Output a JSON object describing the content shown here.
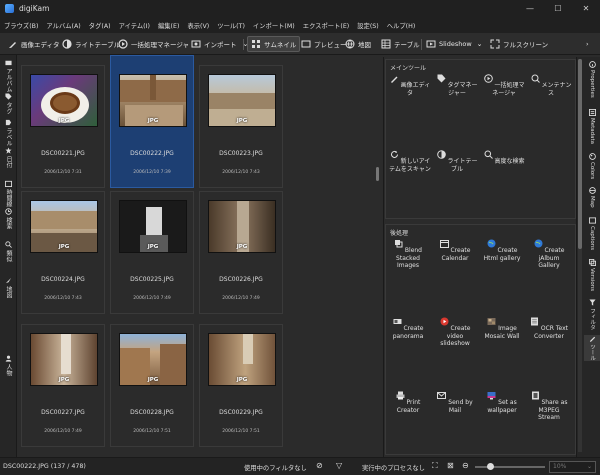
{
  "window": {
    "title": "digiKam",
    "controls": [
      "minimize-icon",
      "maximize-icon",
      "close-icon"
    ]
  },
  "menu": [
    "ブラウズ(B)",
    "アルバム(A)",
    "タグ(A)",
    "アイテム(I)",
    "編集(E)",
    "表示(V)",
    "ツール(T)",
    "インポート(M)",
    "エクスポート(E)",
    "設定(S)",
    "ヘルプ(H)"
  ],
  "toolbar": {
    "image_editor": "画像エディタ",
    "light_table": "ライトテーブル",
    "batch_queue": "一括処理マネージャ",
    "import": "インポート",
    "thumbnails": "サムネイル",
    "preview": "プレビュー",
    "map": "地図",
    "table": "テーブル",
    "slideshow": "Slideshow",
    "fullscreen": "フルスクリーン"
  },
  "left_tabs": [
    "アルバム",
    "タグ",
    "ラベル",
    "日付",
    "時間線",
    "検索",
    "類似",
    "地図",
    "人物"
  ],
  "thumbnails": [
    {
      "name": "DSC00221.JPG",
      "date": "2006/12/10 7:31",
      "badge": "JPG",
      "selected": false
    },
    {
      "name": "DSC00222.JPG",
      "date": "2006/12/10 7:39",
      "badge": "JPG",
      "selected": true
    },
    {
      "name": "DSC00223.JPG",
      "date": "2006/12/10 7:43",
      "badge": "JPG",
      "selected": false
    },
    {
      "name": "DSC00224.JPG",
      "date": "2006/12/10 7:43",
      "badge": "JPG",
      "selected": false
    },
    {
      "name": "DSC00225.JPG",
      "date": "2006/12/10 7:49",
      "badge": "JPG",
      "selected": false
    },
    {
      "name": "DSC00226.JPG",
      "date": "2006/12/10 7:49",
      "badge": "JPG",
      "selected": false
    },
    {
      "name": "DSC00227.JPG",
      "date": "2006/12/10 7:49",
      "badge": "JPG",
      "selected": false
    },
    {
      "name": "DSC00228.JPG",
      "date": "2006/12/10 7:51",
      "badge": "JPG",
      "selected": false
    },
    {
      "name": "DSC00229.JPG",
      "date": "2006/12/10 7:51",
      "badge": "JPG",
      "selected": false
    }
  ],
  "main_tools": {
    "header": "メインツール",
    "items": [
      "画像エディタ",
      "タグマネージャー",
      "一括処理マネージャ",
      "メンテナンス",
      "新しいアイテムをスキャン",
      "ライトテーブル",
      "高度な検索"
    ]
  },
  "post_processing": {
    "header": "後処理",
    "items": [
      "Blend Stacked Images",
      "Create Calendar",
      "Create Html gallery",
      "Create jAlbum Gallery",
      "Create panorama",
      "Create video slideshow",
      "Image Mosaic Wall",
      "OCR Text Converter",
      "Print Creator",
      "Send by Mail",
      "Set as wallpaper",
      "Share as M3PEG Stream"
    ]
  },
  "right_tabs": [
    "Properties",
    "Metadata",
    "Colors",
    "Map",
    "Captions",
    "Versions",
    "フィルタ",
    "ツール"
  ],
  "status": {
    "selection": "DSC00222.JPG (137 / 478)",
    "filter": "使用中のフィルタなし",
    "process": "実行中のプロセスなし",
    "zoom": "10%"
  }
}
